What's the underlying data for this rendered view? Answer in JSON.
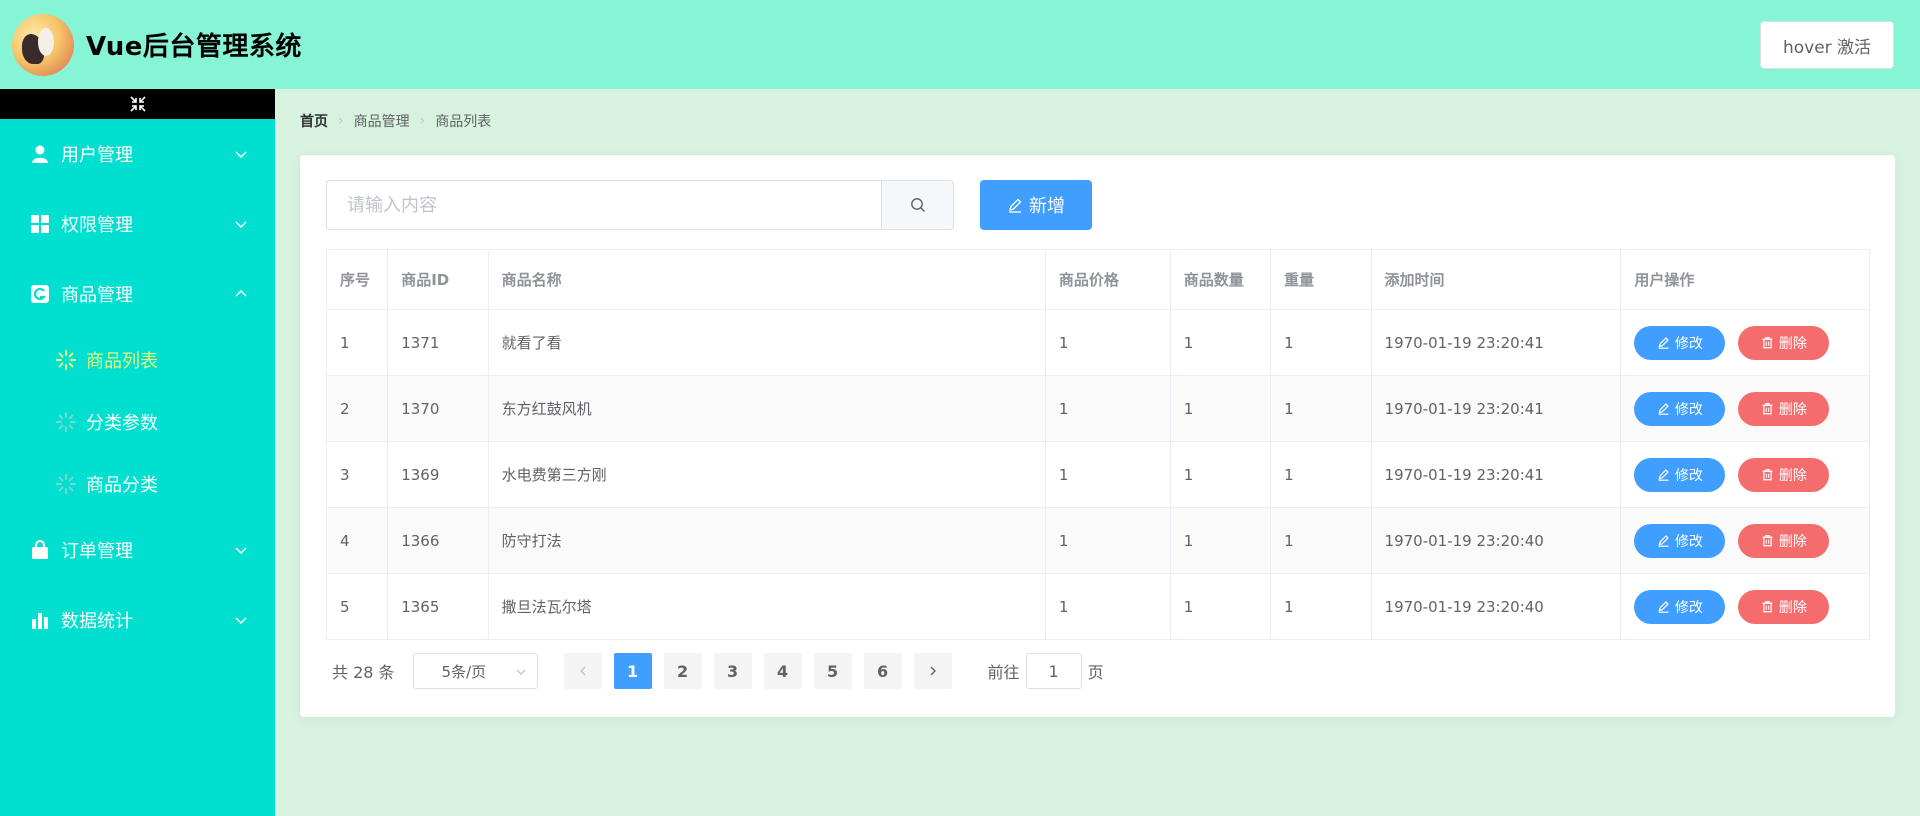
{
  "header": {
    "app_title": "Vue后台管理系统",
    "hover_button": "hover 激活"
  },
  "sidebar": {
    "items": [
      {
        "label": "用户管理",
        "icon": "user-icon",
        "expanded": false
      },
      {
        "label": "权限管理",
        "icon": "grid-icon",
        "expanded": false
      },
      {
        "label": "商品管理",
        "icon": "goods-icon",
        "expanded": true,
        "children": [
          {
            "label": "商品列表",
            "active": true
          },
          {
            "label": "分类参数",
            "active": false
          },
          {
            "label": "商品分类",
            "active": false
          }
        ]
      },
      {
        "label": "订单管理",
        "icon": "bag-icon",
        "expanded": false
      },
      {
        "label": "数据统计",
        "icon": "bar-chart-icon",
        "expanded": false
      }
    ]
  },
  "breadcrumb": [
    "首页",
    "商品管理",
    "商品列表"
  ],
  "search": {
    "placeholder": "请输入内容",
    "add_label": "新增"
  },
  "table": {
    "headers": [
      "序号",
      "商品ID",
      "商品名称",
      "商品价格",
      "商品数量",
      "重量",
      "添加时间",
      "用户操作"
    ],
    "rows": [
      [
        "1",
        "1371",
        "就看了看",
        "1",
        "1",
        "1",
        "1970-01-19 23:20:41"
      ],
      [
        "2",
        "1370",
        "东方红鼓风机",
        "1",
        "1",
        "1",
        "1970-01-19 23:20:41"
      ],
      [
        "3",
        "1369",
        "水电费第三方刚",
        "1",
        "1",
        "1",
        "1970-01-19 23:20:41"
      ],
      [
        "4",
        "1366",
        "防守打法",
        "1",
        "1",
        "1",
        "1970-01-19 23:20:40"
      ],
      [
        "5",
        "1365",
        "撒旦法瓦尔塔",
        "1",
        "1",
        "1",
        "1970-01-19 23:20:40"
      ]
    ],
    "edit_label": "修改",
    "delete_label": "删除"
  },
  "pagination": {
    "total_text": "共 28 条",
    "page_size": "5条/页",
    "pages": [
      "1",
      "2",
      "3",
      "4",
      "5",
      "6"
    ],
    "current_page": "1",
    "goto_prefix": "前往",
    "goto_value": "1",
    "goto_suffix": "页"
  },
  "colors": {
    "header_bg": "#86f5d6",
    "sidebar_bg": "#00dfd0",
    "main_bg": "#d8f2e0",
    "primary": "#409eff",
    "danger": "#f56c6c",
    "active_submenu": "#e8f77a"
  }
}
